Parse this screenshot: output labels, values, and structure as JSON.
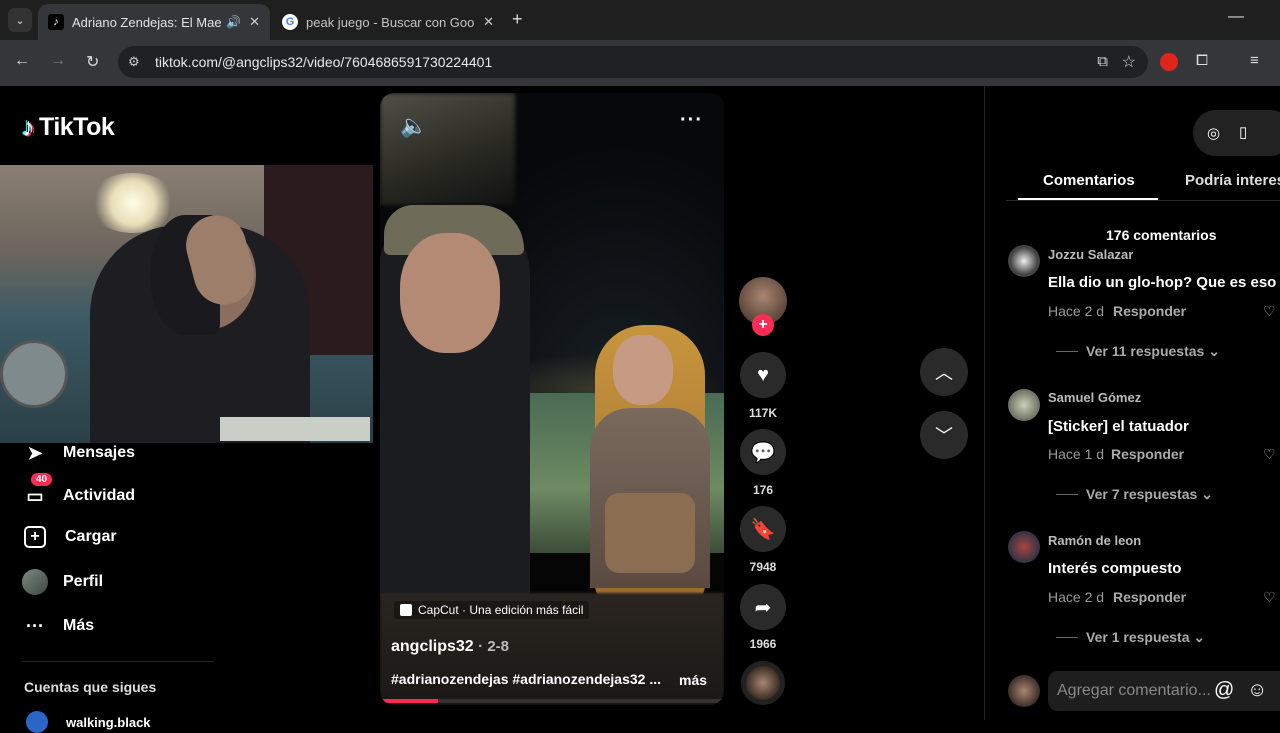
{
  "browser": {
    "tabs": [
      {
        "title": "Adriano Zendejas: El Maestro",
        "active": true,
        "favicon": "tiktok-icon"
      },
      {
        "title": "peak juego - Buscar con Google",
        "active": false,
        "favicon": "google-icon"
      }
    ],
    "url": "tiktok.com/@angclips32/video/7604686591730224401"
  },
  "sidebar": {
    "logo": "TikTok",
    "items": [
      {
        "label": "Mensajes",
        "icon": "send-icon",
        "badge": ""
      },
      {
        "label": "Actividad",
        "icon": "inbox-icon",
        "badge": "40"
      },
      {
        "label": "Cargar",
        "icon": "plus-square-icon",
        "badge": ""
      },
      {
        "label": "Perfil",
        "icon": "avatar",
        "badge": ""
      },
      {
        "label": "Más",
        "icon": "more-icon",
        "badge": ""
      }
    ],
    "following_title": "Cuentas que sigues",
    "following_first": "walking.black"
  },
  "video": {
    "watermark": "CapCut · Una edición más fácil",
    "author": "angclips32",
    "date": "· 2-8",
    "description": "#adrianozendejas #adrianozendejas32 ...",
    "more": "más",
    "progress": 0.17,
    "actions": {
      "likes": "117K",
      "comments": "176",
      "saves": "7948",
      "shares": "1966"
    }
  },
  "comments_panel": {
    "tabs": [
      "Comentarios",
      "Podría interesarte"
    ],
    "count": "176 comentarios",
    "comments": [
      {
        "user": "Jozzu Salazar",
        "text": "Ella dio un glo-hop? Que es eso w",
        "time": "Hace 2 d",
        "reply": "Responder",
        "replies": "Ver 11 respuestas ⌄"
      },
      {
        "user": "Samuel Gómez",
        "text": "[Sticker] el tatuador",
        "time": "Hace 1 d",
        "reply": "Responder",
        "replies": "Ver 7 respuestas ⌄"
      },
      {
        "user": "Ramón de leon",
        "text": "Interés compuesto",
        "time": "Hace 2 d",
        "reply": "Responder",
        "replies": "Ver 1 respuesta ⌄"
      }
    ],
    "input_placeholder": "Agregar comentario..."
  },
  "colors": {
    "accent": "#fe2c55",
    "background": "#000000",
    "chrome": "#35363a"
  }
}
